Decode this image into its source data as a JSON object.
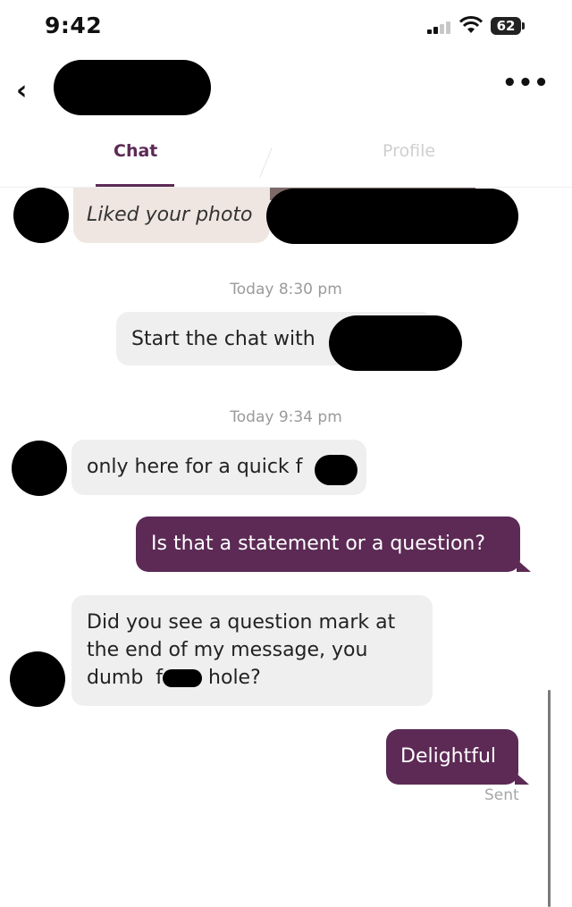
{
  "status_bar": {
    "time": "9:42",
    "battery": "62",
    "icons": [
      "signal-icon",
      "wifi-icon",
      "battery-icon"
    ]
  },
  "header": {
    "back_icon": "chevron-left-icon",
    "back_glyph": "‹",
    "more_icon": "more-icon",
    "more_glyph": "•••"
  },
  "tabs": [
    {
      "label": "Chat",
      "active": true
    },
    {
      "label": "Profile",
      "active": false
    }
  ],
  "messages": {
    "liked": "Liked your photo",
    "stamp_1": "Today 8:30 pm",
    "system_start": "Start the chat with",
    "stamp_2": "Today 9:34 pm",
    "incoming_1": "only here for a quick f",
    "outgoing_1": "Is that a statement or a question?",
    "incoming_2_line1": "Did you see a question mark at",
    "incoming_2_line2": "the end of my message, you",
    "incoming_2_prefix": "dumb  f",
    "incoming_2_suffix": " hole?",
    "outgoing_2": "Delightful",
    "outgoing_2_status": "Sent"
  },
  "colors": {
    "accent": "#5c2a55",
    "incoming_bubble": "#efefef",
    "liked_card": "#efe6e1"
  }
}
